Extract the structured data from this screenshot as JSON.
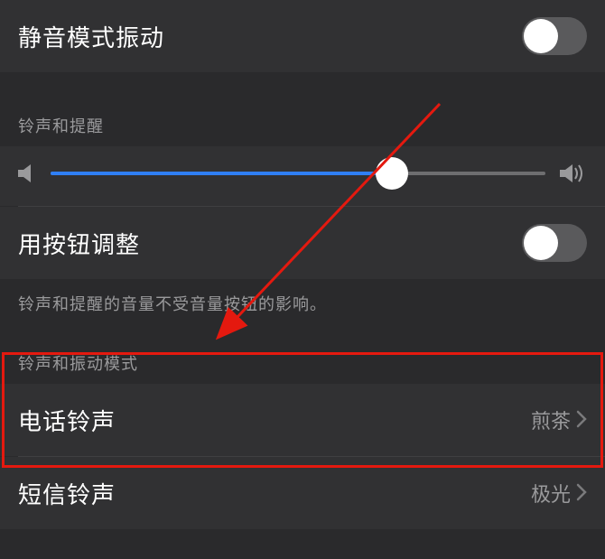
{
  "rows": {
    "silent_vibrate": {
      "label": "静音模式振动",
      "toggle": false
    },
    "button_adjust": {
      "label": "用按钮调整",
      "toggle": false
    },
    "phone_ringtone": {
      "label": "电话铃声",
      "value": "煎茶"
    },
    "sms_ringtone": {
      "label": "短信铃声",
      "value": "极光"
    }
  },
  "sections": {
    "ringer_alerts": "铃声和提醒",
    "ringtone_vibration": "铃声和振动模式"
  },
  "footer": {
    "button_adjust_note": "铃声和提醒的音量不受音量按钮的影响。"
  },
  "slider": {
    "value_percent": 69
  },
  "annotation": {
    "highlight_target": "phone-ringtone-row"
  }
}
